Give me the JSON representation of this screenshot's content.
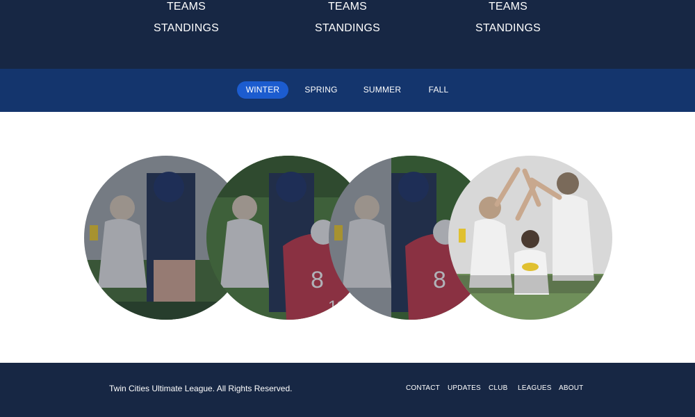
{
  "top_nav": {
    "columns": [
      {
        "teams": "TEAMS",
        "standings": "STANDINGS"
      },
      {
        "teams": "TEAMS",
        "standings": "STANDINGS"
      },
      {
        "teams": "TEAMS",
        "standings": "STANDINGS"
      }
    ]
  },
  "seasons": {
    "tabs": [
      "WINTER",
      "SPRING",
      "SUMMER",
      "FALL"
    ],
    "active": "WINTER"
  },
  "gallery": {
    "slide_count": 5,
    "active_slide": 5
  },
  "footer": {
    "copyright": "Twin Cities Ultimate League. All Rights Reserved.",
    "links": [
      "CONTACT",
      "UPDATES",
      "CLUB",
      "LEAGUES",
      "ABOUT"
    ]
  },
  "colors": {
    "header_bg": "#172744",
    "season_bar_bg": "#14356d",
    "active_tab_bg": "#1c5ccf",
    "footer_bg": "#172744",
    "jersey_red": "#b83a48",
    "grass_green": "#3f6b33"
  }
}
